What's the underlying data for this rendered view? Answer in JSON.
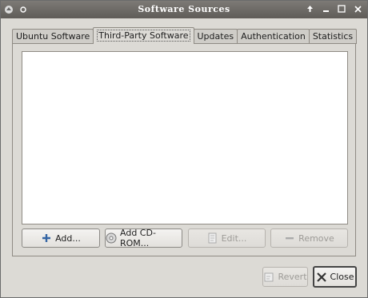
{
  "window": {
    "title": "Software Sources"
  },
  "tabs": [
    {
      "label": "Ubuntu Software"
    },
    {
      "label": "Third-Party Software"
    },
    {
      "label": "Updates"
    },
    {
      "label": "Authentication"
    },
    {
      "label": "Statistics"
    }
  ],
  "panel_buttons": {
    "add_label": "Add...",
    "add_cdrom_label": "Add CD-ROM...",
    "edit_label": "Edit...",
    "remove_label": "Remove"
  },
  "dialog_buttons": {
    "revert_label": "Revert",
    "close_label": "Close"
  },
  "icons": {
    "add": "plus-icon",
    "add_cdrom": "cdrom-icon",
    "edit": "edit-icon",
    "remove": "minus-icon",
    "revert": "revert-icon",
    "close": "close-icon"
  },
  "colors": {
    "accent_blue": "#3465a4",
    "window_bg": "#dcdad5"
  }
}
